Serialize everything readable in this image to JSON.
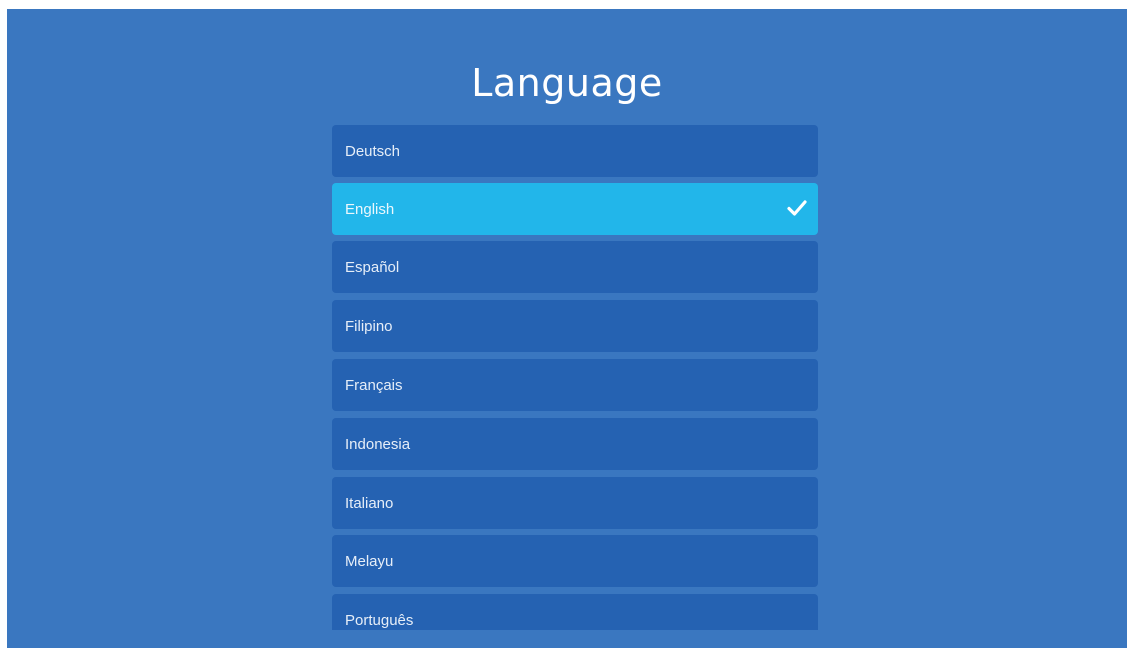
{
  "screen": {
    "title": "Language",
    "background_color": "#3a77c0"
  },
  "language_list": {
    "item_color": "#2562b2",
    "selected_color": "#22b6ea",
    "selected_index": 1,
    "items": [
      {
        "label": "Deutsch",
        "selected": false
      },
      {
        "label": "English",
        "selected": true,
        "icon": "checkmark-icon"
      },
      {
        "label": "Español",
        "selected": false
      },
      {
        "label": "Filipino",
        "selected": false
      },
      {
        "label": "Français",
        "selected": false
      },
      {
        "label": "Indonesia",
        "selected": false
      },
      {
        "label": "Italiano",
        "selected": false
      },
      {
        "label": "Melayu",
        "selected": false
      },
      {
        "label": "Português",
        "selected": false
      }
    ]
  }
}
